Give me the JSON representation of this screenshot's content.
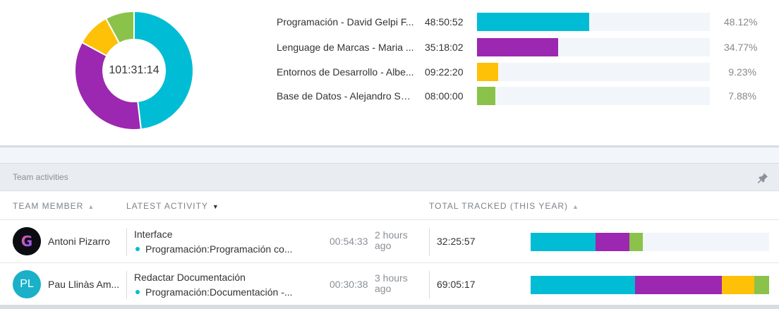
{
  "colors": {
    "programacion": "#00bcd4",
    "lenguage": "#9c27b0",
    "entornos": "#ffc107",
    "bases": "#8bc34a"
  },
  "donut": {
    "total": "101:31:14"
  },
  "projects": [
    {
      "name": "Programación - David Gelpi F...",
      "time": "48:50:52",
      "pct": "48.12%",
      "fraction": 0.4812,
      "color": "#00bcd4"
    },
    {
      "name": "Lenguage de Marcas - Maria ...",
      "time": "35:18:02",
      "pct": "34.77%",
      "fraction": 0.3477,
      "color": "#9c27b0"
    },
    {
      "name": "Entornos de Desarrollo - Albe...",
      "time": "09:22:20",
      "pct": "9.23%",
      "fraction": 0.0923,
      "color": "#ffc107"
    },
    {
      "name": "Base de Datos - Alejandro Sa...",
      "time": "08:00:00",
      "pct": "7.88%",
      "fraction": 0.0788,
      "color": "#8bc34a"
    }
  ],
  "team_panel": {
    "title": "Team activities",
    "pin_icon": "pin-icon",
    "columns": {
      "member": "TEAM MEMBER",
      "activity": "LATEST ACTIVITY",
      "total": "TOTAL TRACKED (THIS YEAR)"
    },
    "rows": [
      {
        "avatar_type": "image",
        "avatar_letter": "G",
        "name": "Antoni Pizarro",
        "activity_title": "Interface",
        "activity_project": "Programación:Programación co...",
        "duration": "00:54:33",
        "ago": "2 hours ago",
        "total": "32:25:57",
        "breakdown": [
          {
            "fraction": 0.273,
            "color": "#00bcd4"
          },
          {
            "fraction": 0.142,
            "color": "#9c27b0"
          },
          {
            "fraction": 0.056,
            "color": "#8bc34a"
          }
        ]
      },
      {
        "avatar_type": "initials",
        "avatar_initials": "PL",
        "name": "Pau Llinàs Am...",
        "activity_title": "Redactar Documentación",
        "activity_project": "Programación:Documentación -...",
        "duration": "00:30:38",
        "ago": "3 hours ago",
        "total": "69:05:17",
        "breakdown": [
          {
            "fraction": 0.438,
            "color": "#00bcd4"
          },
          {
            "fraction": 0.364,
            "color": "#9c27b0"
          },
          {
            "fraction": 0.136,
            "color": "#ffc107"
          },
          {
            "fraction": 0.062,
            "color": "#8bc34a"
          }
        ]
      }
    ]
  }
}
